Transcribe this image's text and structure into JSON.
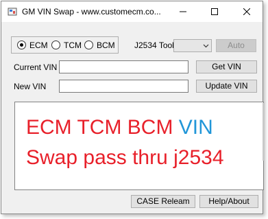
{
  "window": {
    "title": "GM VIN Swap - www.customecm.co...",
    "controls": {
      "minimize": "minimize",
      "maximize": "maximize",
      "close": "close"
    }
  },
  "modules": {
    "options": [
      {
        "label": "ECM",
        "selected": true
      },
      {
        "label": "TCM",
        "selected": false
      },
      {
        "label": "BCM",
        "selected": false
      }
    ]
  },
  "j2534": {
    "label": "J2534 Tool",
    "selected_value": "",
    "auto_label": "Auto"
  },
  "current_vin": {
    "label": "Current VIN",
    "value": "",
    "button": "Get VIN"
  },
  "new_vin": {
    "label": "New VIN",
    "value": "",
    "button": "Update VIN"
  },
  "display": {
    "line1_main": "ECM TCM BCM ",
    "line1_accent": "VIN",
    "line2": "Swap pass thru j2534",
    "colors": {
      "main": "#e8202a",
      "accent": "#2196d8"
    }
  },
  "footer": {
    "case_button": "CASE Releam",
    "help_button": "Help/About"
  },
  "icons": {
    "app": "app-icon",
    "dropdown": "chevron-down-icon"
  }
}
